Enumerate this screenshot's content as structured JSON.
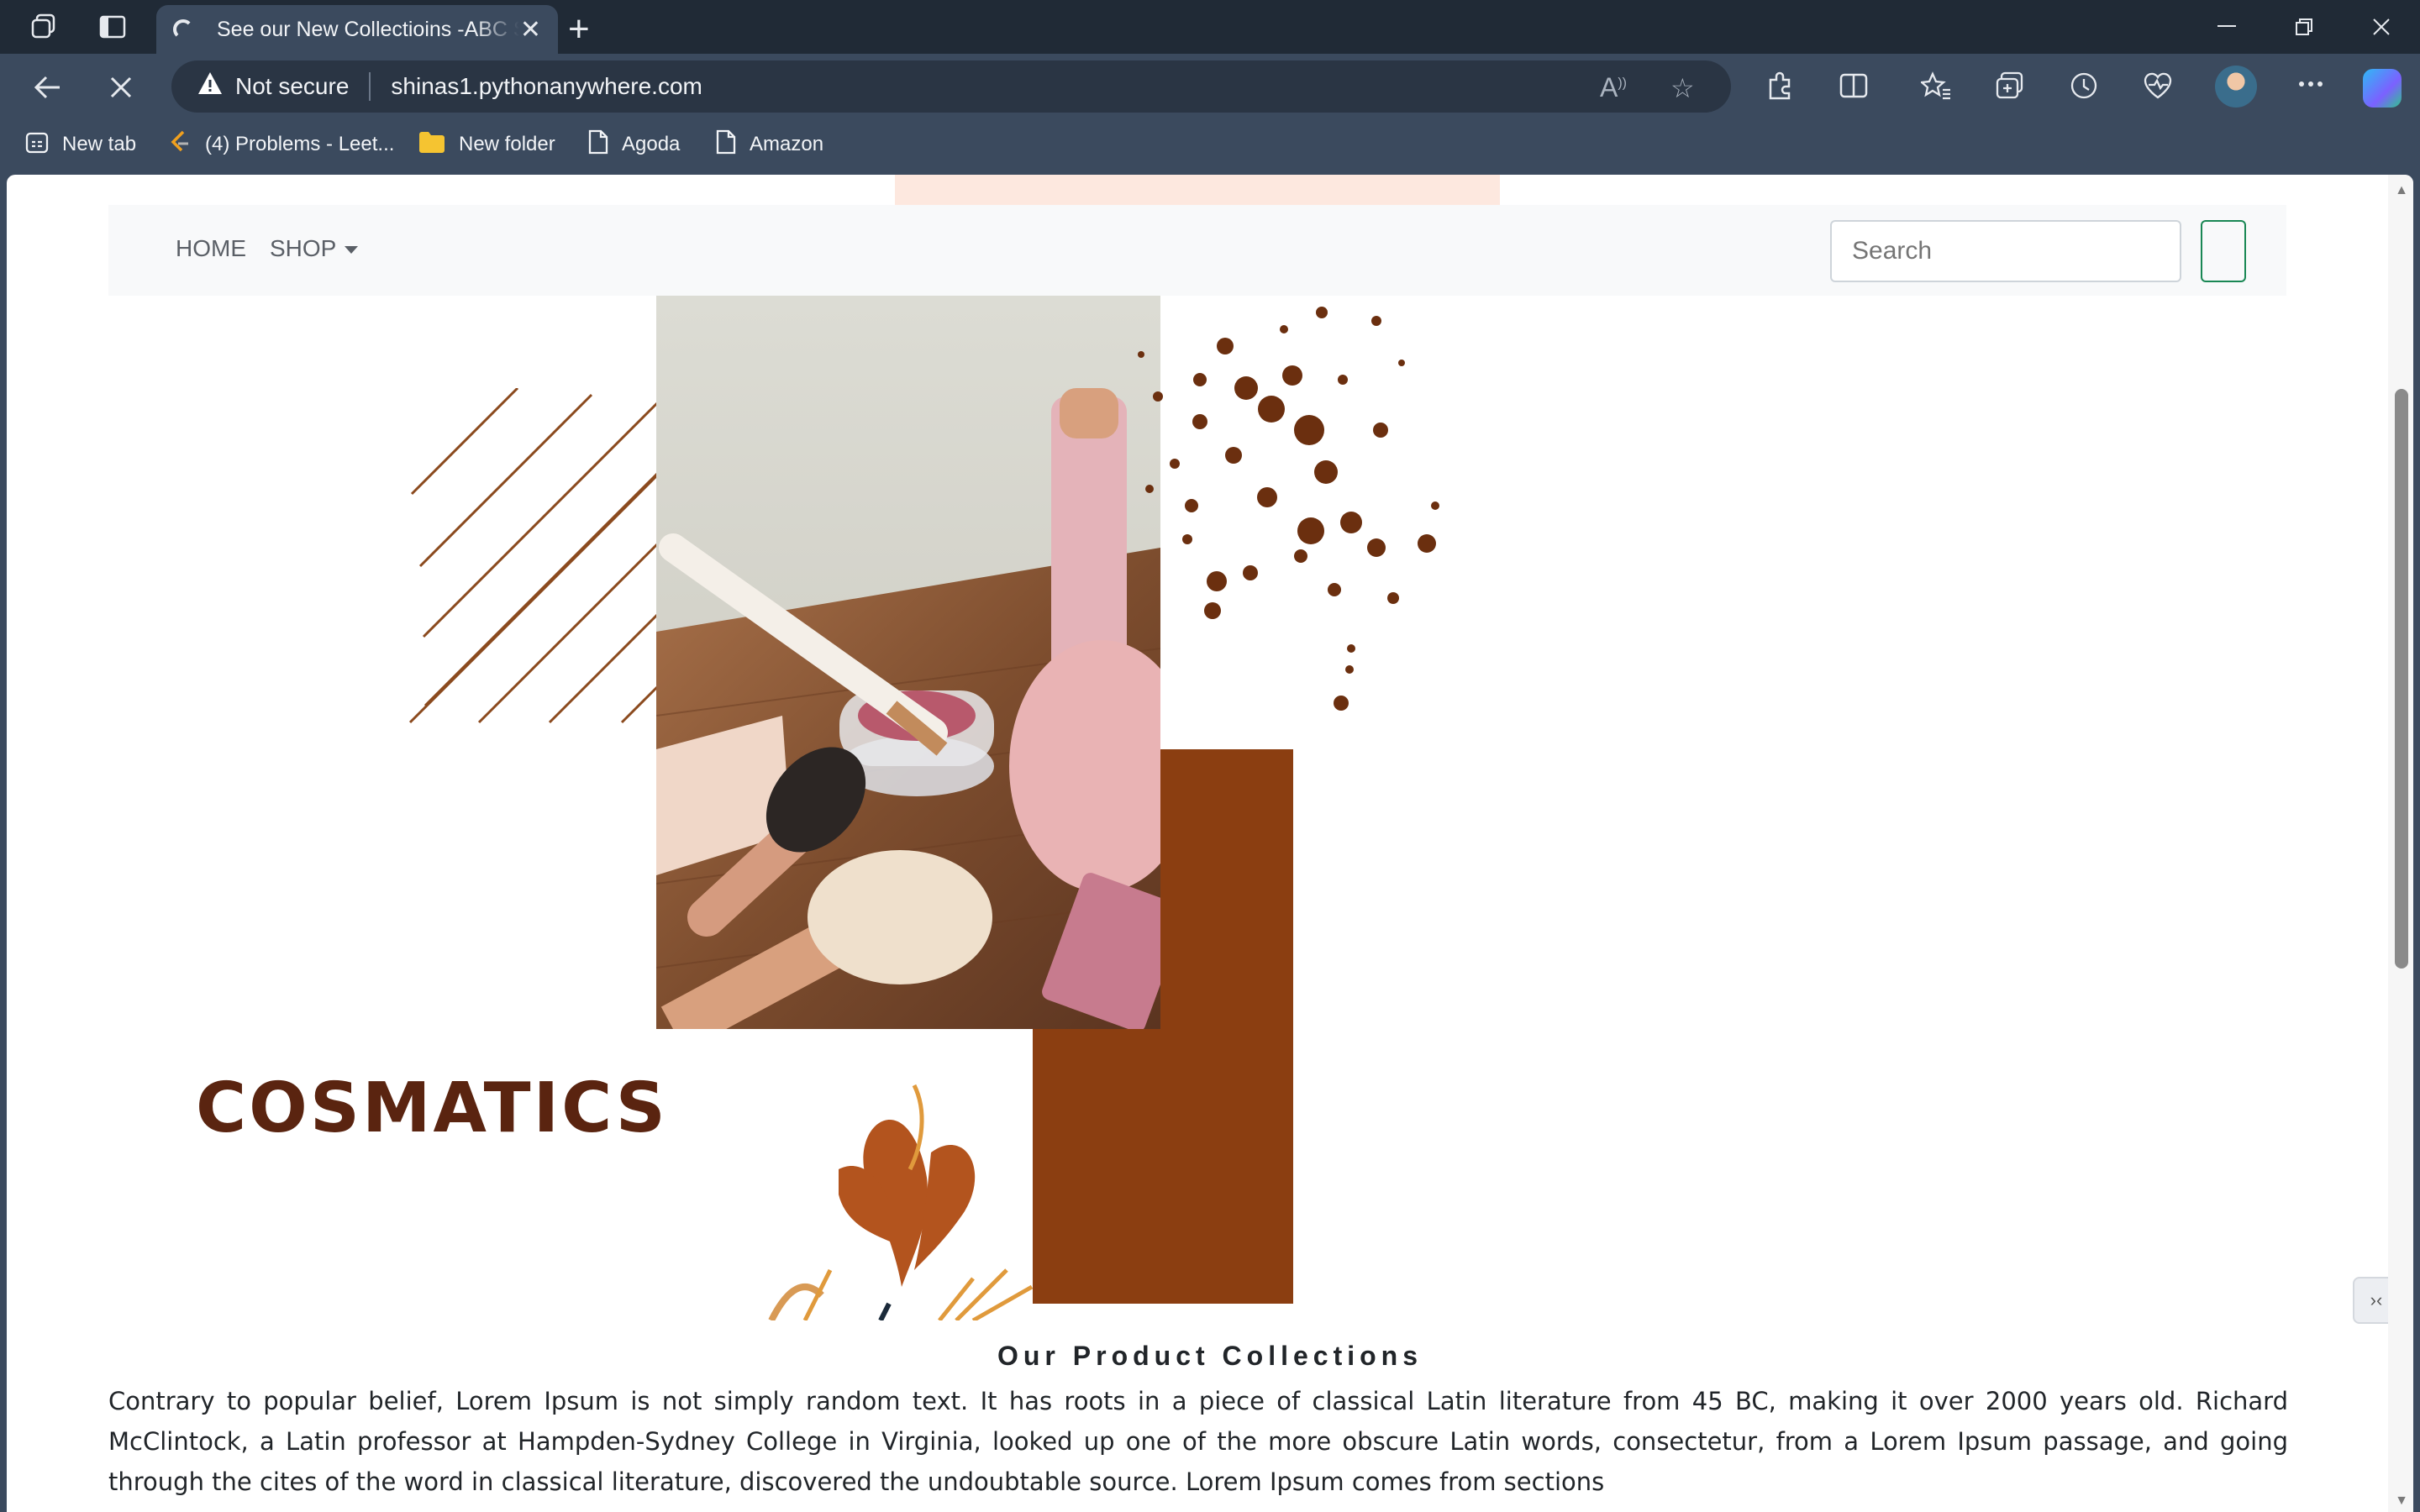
{
  "browser": {
    "tab_title": "See our New Collectioins -ABC Store",
    "tab_close": "✕",
    "new_tab": "+",
    "address": {
      "security_label": "Not secure",
      "url": "shinas1.pythonanywhere.com"
    },
    "bookmarks": [
      {
        "label": "New tab",
        "icon": "new-tab-page-icon"
      },
      {
        "label": "(4) Problems - Leet...",
        "icon": "leetcode-icon"
      },
      {
        "label": "New folder",
        "icon": "folder-icon"
      },
      {
        "label": "Agoda",
        "icon": "page-icon"
      },
      {
        "label": "Amazon",
        "icon": "page-icon"
      }
    ]
  },
  "page": {
    "nav": {
      "home": "HOME",
      "shop": "SHOP",
      "search_placeholder": "Search"
    },
    "hero": {
      "brand": "COSMATICS",
      "accent_color": "#8b3e11"
    },
    "section_title": "Our Product Collections",
    "body_text": "Contrary to popular belief, Lorem Ipsum is not simply random text. It has roots in a piece of classical Latin literature from 45 BC, making it over 2000 years old. Richard McClintock, a Latin professor at Hampden-Sydney College in Virginia, looked up one of the more obscure Latin words, consectetur, from a Lorem Ipsum passage, and going through the cites of the word in classical literature, discovered the undoubtable source. Lorem Ipsum comes from sections"
  }
}
